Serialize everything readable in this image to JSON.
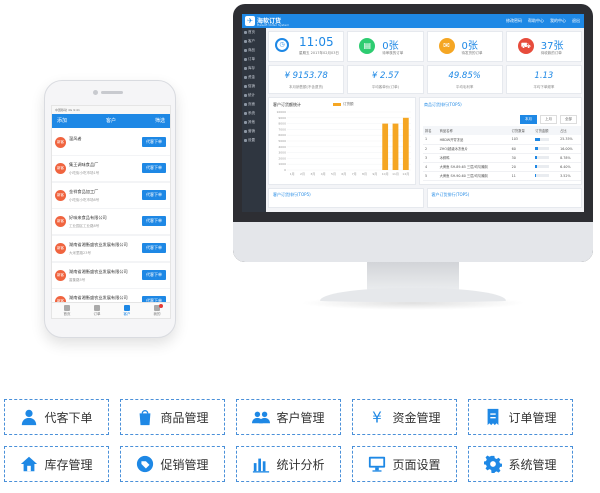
{
  "monitor": {
    "app_name": "海软订货",
    "app_sub": "Haisoft Order System",
    "topnav": [
      "修改密码",
      "帮助中心",
      "我的中心",
      "退出"
    ],
    "sidebar": [
      "首页",
      "客户",
      "商品",
      "订单",
      "库存",
      "资金",
      "促销",
      "统计",
      "页面",
      "系统",
      "其他",
      "营销",
      "设置"
    ],
    "kpis": [
      {
        "icon": "clock-icon",
        "big": "11:05",
        "small": "星期五 2017年02月03日",
        "color": "#1e88e5"
      },
      {
        "icon": "document-icon",
        "big": "0张",
        "small": "待审核的订单",
        "color": "#2ecc71"
      },
      {
        "icon": "mail-icon",
        "big": "0张",
        "small": "待发货的订单",
        "color": "#f5a623"
      },
      {
        "icon": "truck-icon",
        "big": "37张",
        "small": "待收款的订单",
        "color": "#e74c3c"
      }
    ],
    "values": [
      {
        "n": "¥ 9153.78",
        "t": "本月销售额(不含退货)"
      },
      {
        "n": "¥ 2.57",
        "t": "平均客单价(订单)"
      },
      {
        "n": "49.85%",
        "t": "平均毛利率"
      },
      {
        "n": "1.13",
        "t": "平均下单频率"
      }
    ],
    "chart_panel": {
      "title": "客户订货额统计",
      "legend": "订货额"
    },
    "table_panel": {
      "title": "商品订货排行(TOP5)",
      "buttons": [
        "本月",
        "上月",
        "全部"
      ],
      "headers": [
        "排名",
        "商品名称",
        "订货数量",
        "订货金额",
        "占比"
      ],
      "rows": [
        {
          "rank": "1",
          "name": "HBDW开胃冻品",
          "qty": "103",
          "pct": "25.35%",
          "fill": 0.35
        },
        {
          "rank": "2",
          "name": "ZHO/超级冰冻鱼片",
          "qty": "60",
          "pct": "16.00%",
          "fill": 0.22
        },
        {
          "rank": "3",
          "name": "冰鲜鸭",
          "qty": "30",
          "pct": "8.78%",
          "fill": 0.12
        },
        {
          "rank": "4",
          "name": "大黄鱼 SH-89-65 三层/均匀腌制",
          "qty": "20",
          "pct": "6.40%",
          "fill": 0.09
        },
        {
          "rank": "5",
          "name": "大黄鱼 SH-90-60 三层/均匀腌制",
          "qty": "11",
          "pct": "3.52%",
          "fill": 0.05
        }
      ]
    },
    "bottom_panels": [
      "客户订货排行(TOP5)",
      "客户订货排行(TOP5)"
    ]
  },
  "chart_data": {
    "type": "bar",
    "categories": [
      "1月",
      "2月",
      "3月",
      "4月",
      "5月",
      "6月",
      "7月",
      "8月",
      "9月",
      "10月",
      "11月",
      "12月"
    ],
    "series": [
      {
        "name": "订货额",
        "values": [
          0,
          0,
          0,
          0,
          0,
          0,
          0,
          0,
          0,
          8000,
          8000,
          9000
        ]
      }
    ],
    "ylim": [
      0,
      10000
    ],
    "yticks": [
      "10000",
      "9000",
      "8000",
      "7000",
      "6000",
      "5000",
      "4000",
      "3000",
      "2000",
      "1000",
      "0"
    ],
    "color": "#f5a623"
  },
  "phone": {
    "status": "中国移动 4G 9:41",
    "header": {
      "left": "添加",
      "center": "客户",
      "right": "筛选"
    },
    "button_label": "代客下单",
    "customers": [
      {
        "tag": "新客",
        "name": "温风者",
        "addr": ""
      },
      {
        "tag": "新客",
        "name": "集王调味食品厂",
        "addr": "小吃街小吃市场1号"
      },
      {
        "tag": "新客",
        "name": "金祥食品加工厂",
        "addr": "小吃街小吃市场8号"
      },
      {
        "tag": "新客",
        "name": "好味来食品有限公司",
        "addr": "工业园区工业路8号"
      },
      {
        "tag": "新客",
        "name": "湖南省湘衡盛农业发展有限公司",
        "addr": "大米里路23号"
      },
      {
        "tag": "新客",
        "name": "湖南省湘衡盛农业发展有限公司",
        "addr": "香集路5号"
      },
      {
        "tag": "新客",
        "name": "湖南省湘衡盛农业发展有限公司",
        "addr": ""
      }
    ],
    "tabs": [
      "首页",
      "订单",
      "客户",
      "我的"
    ]
  },
  "features": [
    {
      "label": "代客下单",
      "icon": "user-icon"
    },
    {
      "label": "商品管理",
      "icon": "shopping-bag-icon"
    },
    {
      "label": "客户管理",
      "icon": "users-icon"
    },
    {
      "label": "资金管理",
      "icon": "yen-icon"
    },
    {
      "label": "订单管理",
      "icon": "receipt-icon"
    },
    {
      "label": "库存管理",
      "icon": "home-icon"
    },
    {
      "label": "促销管理",
      "icon": "tag-icon"
    },
    {
      "label": "统计分析",
      "icon": "bar-chart-icon"
    },
    {
      "label": "页面设置",
      "icon": "monitor-icon"
    },
    {
      "label": "系统管理",
      "icon": "gear-icon"
    }
  ]
}
